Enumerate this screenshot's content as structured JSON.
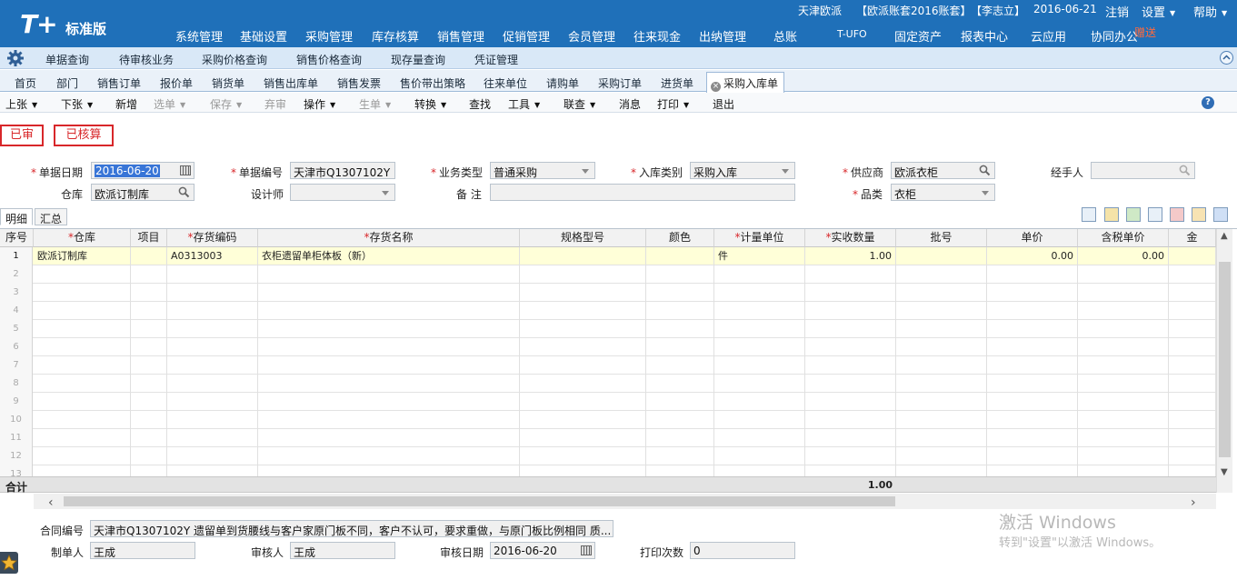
{
  "app": {
    "logo_text": "T+",
    "edition": "标准版",
    "company": "天津欧派",
    "account": "【欧派账套2016账套】",
    "user": "【李志立】",
    "date": "2016-06-21",
    "logout": "注销",
    "settings": "设置",
    "help": "帮助",
    "gift_badge": "赠送"
  },
  "nav": [
    "系统管理",
    "基础设置",
    "采购管理",
    "库存核算",
    "销售管理",
    "促销管理",
    "会员管理",
    "往来现金",
    "出纳管理",
    "总账",
    "T-UFO",
    "固定资产",
    "报表中心",
    "云应用",
    "协同办公"
  ],
  "quickbar": [
    "单据查询",
    "待审核业务",
    "采购价格查询",
    "销售价格查询",
    "现存量查询",
    "凭证管理"
  ],
  "tabs": [
    "首页",
    "部门",
    "销售订单",
    "报价单",
    "销货单",
    "销售出库单",
    "销售发票",
    "售价带出策略",
    "往来单位",
    "请购单",
    "采购订单",
    "进货单"
  ],
  "active_tab": "采购入库单",
  "toolbar": [
    {
      "label": "上张",
      "caret": true,
      "disabled": false
    },
    {
      "label": "下张",
      "caret": true,
      "disabled": false
    },
    {
      "label": "新增",
      "caret": false,
      "disabled": false
    },
    {
      "label": "选单",
      "caret": true,
      "disabled": true
    },
    {
      "label": "保存",
      "caret": true,
      "disabled": true
    },
    {
      "label": "弃审",
      "caret": false,
      "disabled": true
    },
    {
      "label": "操作",
      "caret": true,
      "disabled": false
    },
    {
      "label": "生单",
      "caret": true,
      "disabled": true
    },
    {
      "label": "转换",
      "caret": true,
      "disabled": false
    },
    {
      "label": "查找",
      "caret": false,
      "disabled": false
    },
    {
      "label": "工具",
      "caret": true,
      "disabled": false
    },
    {
      "label": "联查",
      "caret": true,
      "disabled": false
    },
    {
      "label": "消息",
      "caret": false,
      "disabled": false
    },
    {
      "label": "打印",
      "caret": true,
      "disabled": false
    },
    {
      "label": "退出",
      "caret": false,
      "disabled": false
    }
  ],
  "stamps": {
    "audited": "已审",
    "accounted": "已核算"
  },
  "form": {
    "date_label": "单据日期",
    "date_value": "2016-06-20",
    "no_label": "单据编号",
    "no_value": "天津市Q1307102Y",
    "biz_type_label": "业务类型",
    "biz_type_value": "普通采购",
    "in_type_label": "入库类别",
    "in_type_value": "采购入库",
    "supplier_label": "供应商",
    "supplier_value": "欧派衣柜",
    "handler_label": "经手人",
    "handler_value": "",
    "warehouse_label": "仓库",
    "warehouse_value": "欧派订制库",
    "designer_label": "设计师",
    "designer_value": "",
    "remark_label": "备 注",
    "remark_value": "",
    "category_label": "品类",
    "category_value": "衣柜"
  },
  "subtabs": {
    "detail": "明细",
    "summary": "汇总"
  },
  "grid": {
    "headers": [
      {
        "label": "序号",
        "req": false
      },
      {
        "label": "仓库",
        "req": true
      },
      {
        "label": "项目",
        "req": false
      },
      {
        "label": "存货编码",
        "req": true
      },
      {
        "label": "存货名称",
        "req": true
      },
      {
        "label": "规格型号",
        "req": false
      },
      {
        "label": "颜色",
        "req": false
      },
      {
        "label": "计量单位",
        "req": true
      },
      {
        "label": "实收数量",
        "req": true
      },
      {
        "label": "批号",
        "req": false
      },
      {
        "label": "单价",
        "req": false
      },
      {
        "label": "含税单价",
        "req": false
      },
      {
        "label": "金",
        "req": false
      }
    ],
    "rows": [
      {
        "no": "1",
        "warehouse": "欧派订制库",
        "project": "",
        "code": "A0313003",
        "name": "衣柜遗留单柜体板（新）",
        "spec": "",
        "color": "",
        "unit": "件",
        "qty": "1.00",
        "batch": "",
        "price": "0.00",
        "tax_price": "0.00",
        "amount": ""
      }
    ],
    "row_numbers": [
      "1",
      "2",
      "3",
      "4",
      "5",
      "6",
      "7",
      "8",
      "9",
      "10",
      "11",
      "12",
      "13"
    ],
    "total_label": "合计",
    "total_qty": "1.00"
  },
  "footer": {
    "contract_label": "合同编号",
    "contract_value": "天津市Q1307102Y 遗留单到货腰线与客户家原门板不同，客户不认可，要求重做，与原门板比例相同 质...",
    "maker_label": "制单人",
    "maker_value": "王成",
    "auditor_label": "审核人",
    "auditor_value": "王成",
    "audit_date_label": "审核日期",
    "audit_date_value": "2016-06-20",
    "print_count_label": "打印次数",
    "print_count_value": "0"
  },
  "watermark": {
    "line1": "激活 Windows",
    "line2": "转到\"设置\"以激活 Windows。"
  },
  "colors": {
    "header_blue": "#1f70b9",
    "required_red": "#d8272a",
    "selected_row": "#ffffd8"
  }
}
